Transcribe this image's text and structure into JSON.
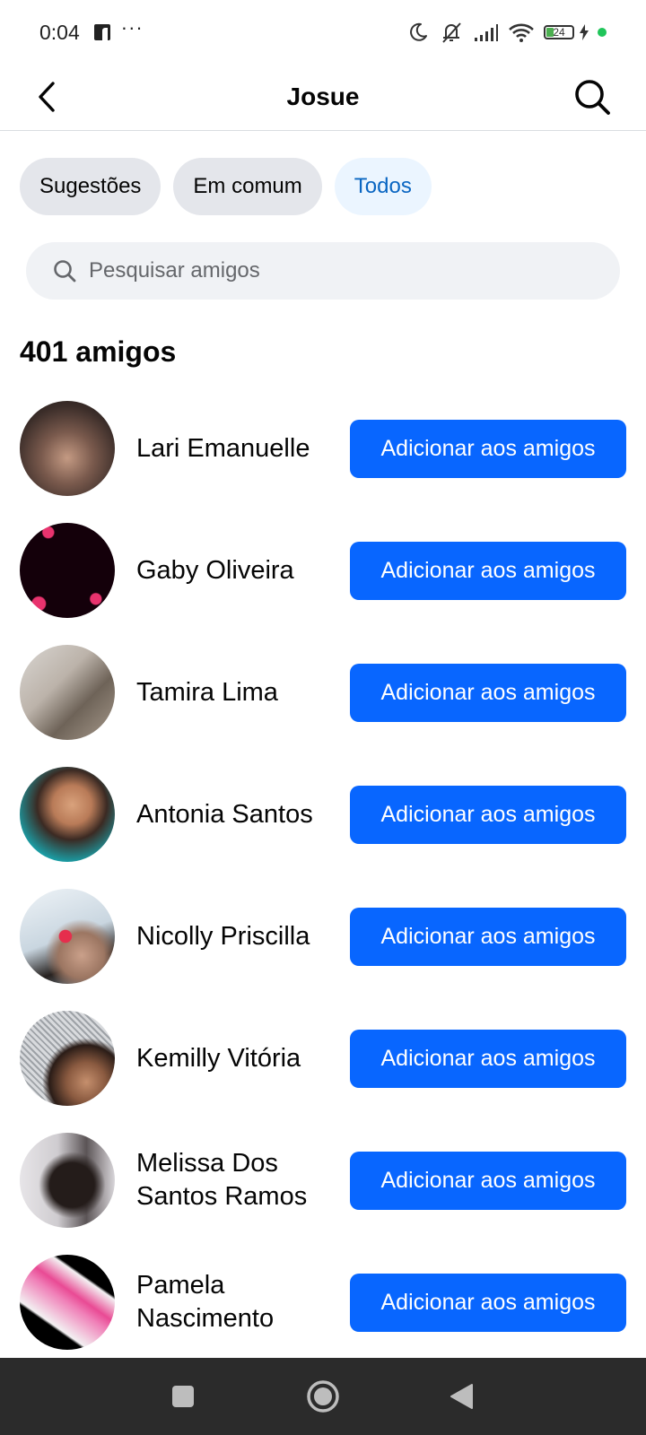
{
  "status_bar": {
    "time": "0:04",
    "overflow": "···",
    "battery_level": "24"
  },
  "header": {
    "title": "Josue"
  },
  "chips": [
    {
      "label": "Sugestões",
      "active": false
    },
    {
      "label": "Em comum",
      "active": false
    },
    {
      "label": "Todos",
      "active": true
    }
  ],
  "search": {
    "placeholder": "Pesquisar amigos",
    "value": ""
  },
  "friends_count": "401 amigos",
  "add_label": "Adicionar aos amigos",
  "friends": [
    {
      "name": "Lari Emanuelle"
    },
    {
      "name": "Gaby Oliveira"
    },
    {
      "name": "Tamira Lima"
    },
    {
      "name": "Antonia Santos"
    },
    {
      "name": "Nicolly Priscilla"
    },
    {
      "name": "Kemilly Vitória"
    },
    {
      "name": "Melissa Dos Santos Ramos"
    },
    {
      "name": "Pamela Nascimento"
    }
  ],
  "colors": {
    "primary_button": "#0866ff",
    "active_chip_bg": "#ebf5ff",
    "active_chip_text": "#0a66c2",
    "chip_bg": "#e4e6eb",
    "search_bg": "#f0f2f5",
    "nav_bar": "#2b2b2b"
  },
  "icons": {
    "back": "chevron-left-icon",
    "search": "search-icon",
    "nav_recents": "square-icon",
    "nav_home": "circle-icon",
    "nav_back": "triangle-left-icon"
  }
}
